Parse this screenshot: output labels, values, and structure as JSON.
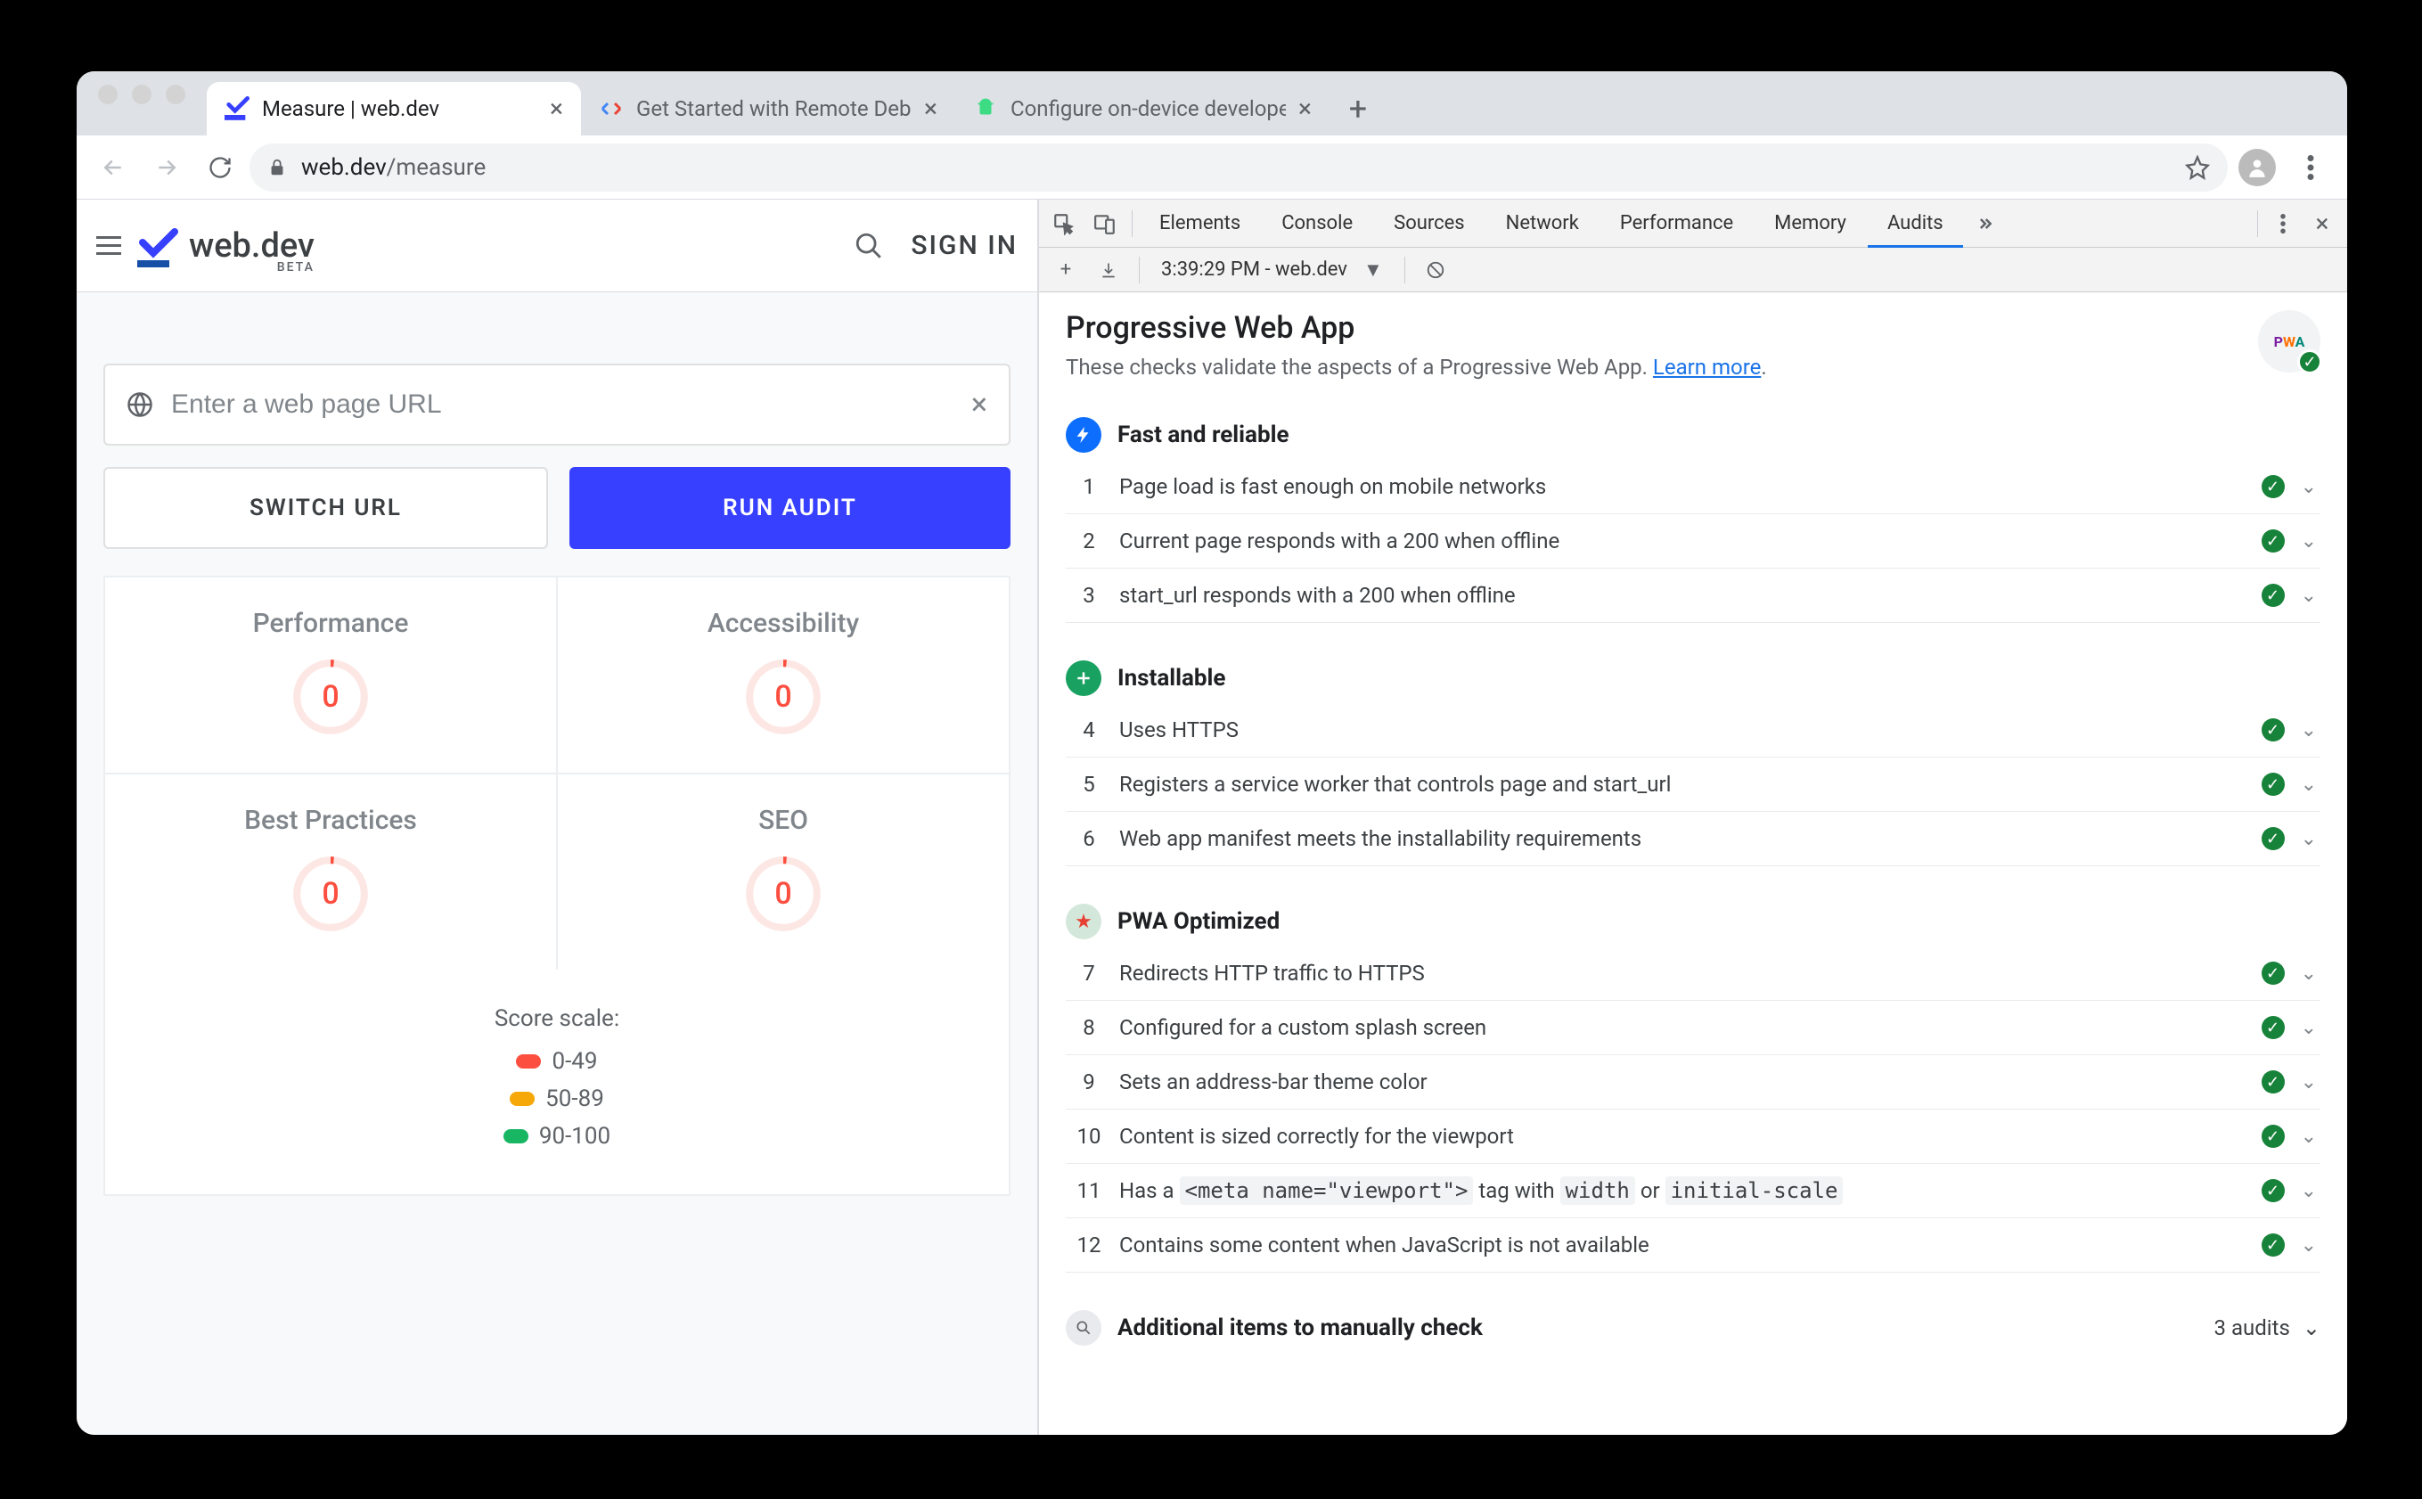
{
  "browser": {
    "tabs": [
      {
        "title": "Measure  |  web.dev",
        "active": true
      },
      {
        "title": "Get Started with Remote Debu",
        "active": false
      },
      {
        "title": "Configure on-device develope",
        "active": false
      }
    ],
    "url_host": "web.dev",
    "url_path": "/measure"
  },
  "page": {
    "logo": "web.dev",
    "logo_sub": "BETA",
    "sign_in": "SIGN IN",
    "url_placeholder": "Enter a web page URL",
    "switch_url": "SWITCH URL",
    "run_audit": "RUN AUDIT",
    "gauges": [
      {
        "label": "Performance",
        "value": "0"
      },
      {
        "label": "Accessibility",
        "value": "0"
      },
      {
        "label": "Best Practices",
        "value": "0"
      },
      {
        "label": "SEO",
        "value": "0"
      }
    ],
    "scale_title": "Score scale:",
    "scale": [
      "0-49",
      "50-89",
      "90-100"
    ]
  },
  "devtools": {
    "tabs": [
      "Elements",
      "Console",
      "Sources",
      "Network",
      "Performance",
      "Memory",
      "Audits"
    ],
    "active_tab": "Audits",
    "subtool_label": "3:39:29 PM - web.dev",
    "title": "Progressive Web App",
    "subtitle_pre": "These checks validate the aspects of a Progressive Web App. ",
    "subtitle_link": "Learn more",
    "sections": [
      {
        "badge": "blue",
        "icon": "bolt",
        "title": "Fast and reliable",
        "audits": [
          {
            "n": "1",
            "t": "Page load is fast enough on mobile networks"
          },
          {
            "n": "2",
            "t": "Current page responds with a 200 when offline"
          },
          {
            "n": "3",
            "t": "start_url responds with a 200 when offline"
          }
        ]
      },
      {
        "badge": "green",
        "icon": "plus",
        "title": "Installable",
        "audits": [
          {
            "n": "4",
            "t": "Uses HTTPS"
          },
          {
            "n": "5",
            "t": "Registers a service worker that controls page and start_url"
          },
          {
            "n": "6",
            "t": "Web app manifest meets the installability requirements"
          }
        ]
      },
      {
        "badge": "star",
        "icon": "star",
        "title": "PWA Optimized",
        "audits": [
          {
            "n": "7",
            "t": "Redirects HTTP traffic to HTTPS"
          },
          {
            "n": "8",
            "t": "Configured for a custom splash screen"
          },
          {
            "n": "9",
            "t": "Sets an address-bar theme color"
          },
          {
            "n": "10",
            "t": "Content is sized correctly for the viewport"
          },
          {
            "n": "11",
            "html": "Has a <code>&lt;meta name=\"viewport\"&gt;</code> tag with <code>width</code> or <code>initial-scale</code>"
          },
          {
            "n": "12",
            "t": "Contains some content when JavaScript is not available"
          }
        ]
      }
    ],
    "manual_title": "Additional items to manually check",
    "manual_count": "3 audits"
  }
}
